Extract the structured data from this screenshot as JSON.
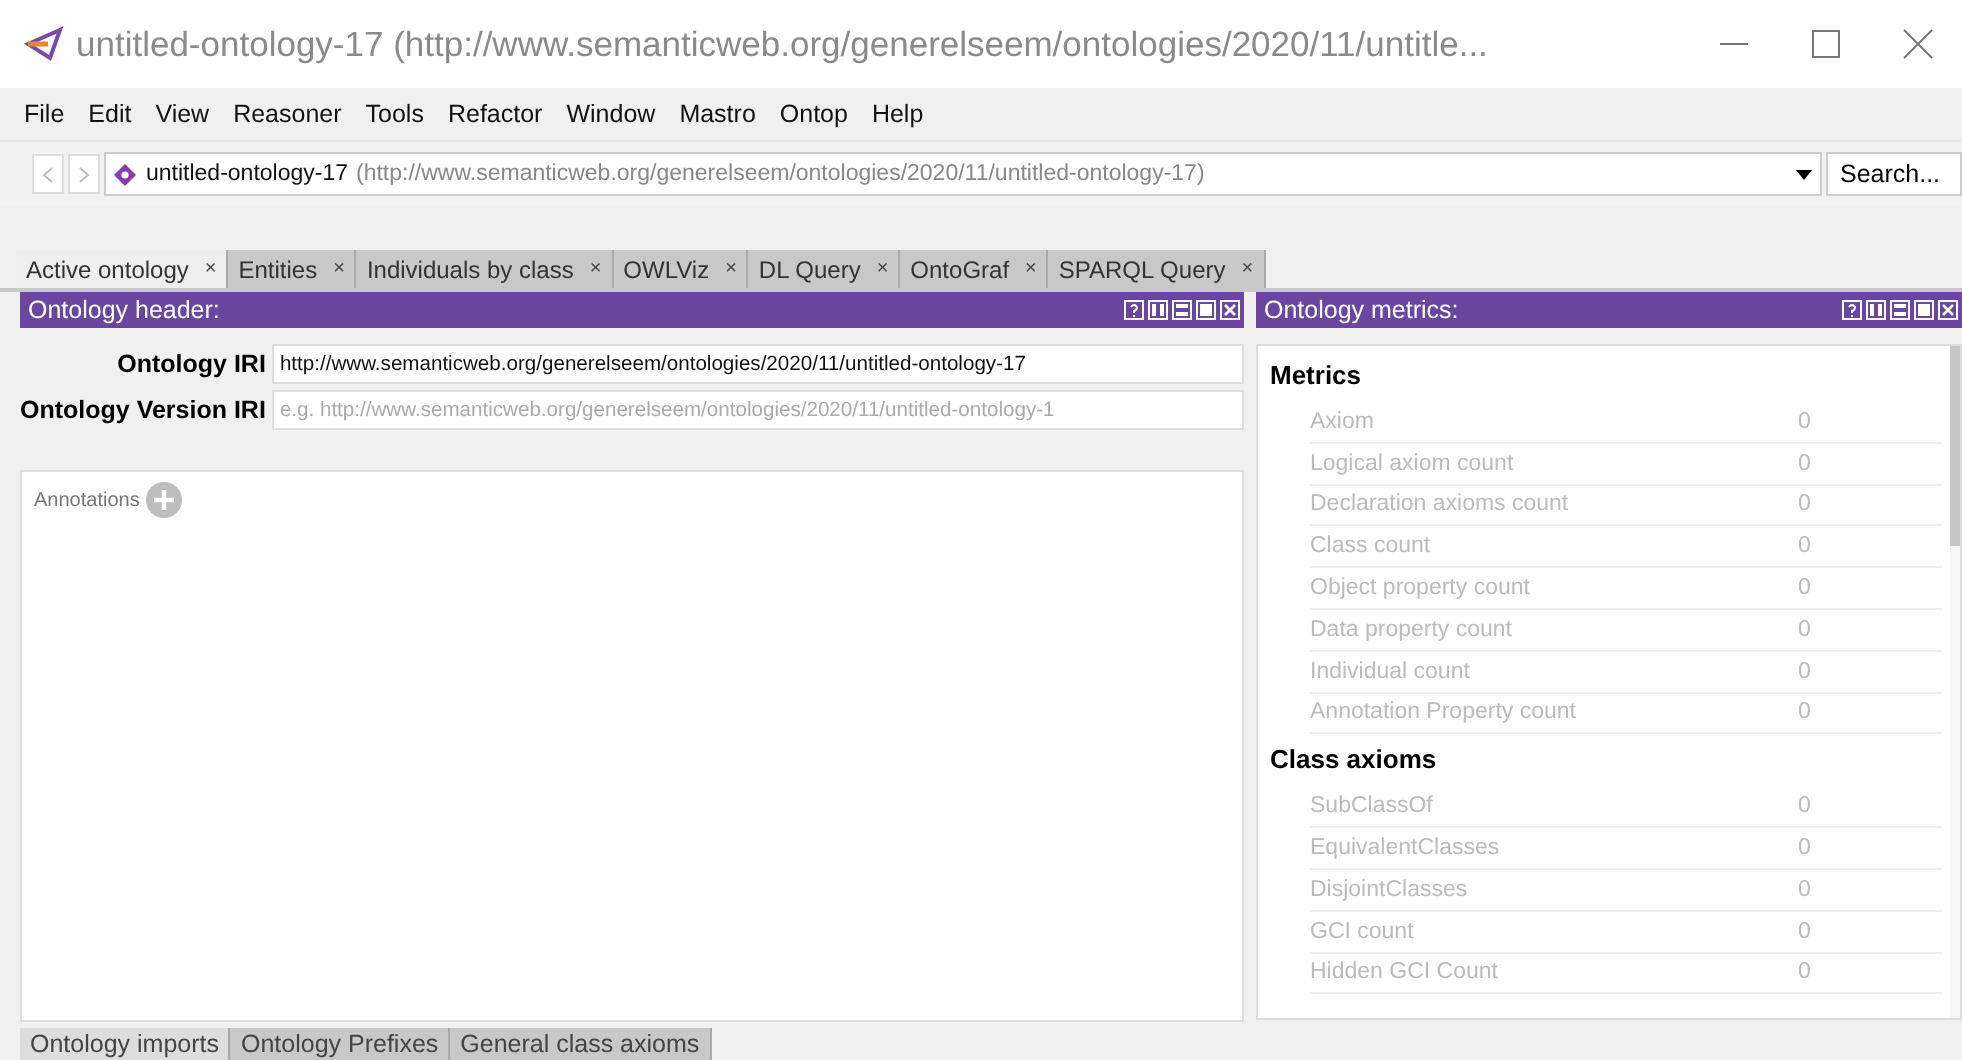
{
  "window": {
    "title": "untitled-ontology-17 (http://www.semanticweb.org/generelseem/ontologies/2020/11/untitle..."
  },
  "menu": [
    "File",
    "Edit",
    "View",
    "Reasoner",
    "Tools",
    "Refactor",
    "Window",
    "Mastro",
    "Ontop",
    "Help"
  ],
  "address": {
    "name": "untitled-ontology-17",
    "iri": "(http://www.semanticweb.org/generelseem/ontologies/2020/11/untitled-ontology-17)",
    "search": "Search..."
  },
  "tabs": [
    {
      "label": "Active ontology",
      "close": "×",
      "selected": true
    },
    {
      "label": "Entities",
      "close": "×",
      "selected": false
    },
    {
      "label": "Individuals by class",
      "close": "×",
      "selected": false
    },
    {
      "label": "OWLViz",
      "close": "×",
      "selected": false
    },
    {
      "label": "DL Query",
      "close": "×",
      "selected": false
    },
    {
      "label": "OntoGraf",
      "close": "×",
      "selected": false
    },
    {
      "label": "SPARQL Query",
      "close": "×",
      "selected": false
    }
  ],
  "header_panel": {
    "title": "Ontology header:",
    "fields": [
      {
        "label": "Ontology IRI",
        "value": "http://www.semanticweb.org/generelseem/ontologies/2020/11/untitled-ontology-17"
      },
      {
        "label": "Ontology Version IRI",
        "placeholder": "e.g. http://www.semanticweb.org/generelseem/ontologies/2020/11/untitled-ontology-1"
      }
    ],
    "annotations": "Annotations"
  },
  "metrics_panel": {
    "title": "Ontology metrics:",
    "sections": [
      {
        "heading": "Metrics",
        "rows": [
          {
            "name": "Axiom",
            "value": "0"
          },
          {
            "name": "Logical axiom count",
            "value": "0"
          },
          {
            "name": "Declaration axioms count",
            "value": "0"
          },
          {
            "name": "Class count",
            "value": "0"
          },
          {
            "name": "Object property count",
            "value": "0"
          },
          {
            "name": "Data property count",
            "value": "0"
          },
          {
            "name": "Individual count",
            "value": "0"
          },
          {
            "name": "Annotation Property count",
            "value": "0"
          }
        ]
      },
      {
        "heading": "Class axioms",
        "rows": [
          {
            "name": "SubClassOf",
            "value": "0"
          },
          {
            "name": "EquivalentClasses",
            "value": "0"
          },
          {
            "name": "DisjointClasses",
            "value": "0"
          },
          {
            "name": "GCI count",
            "value": "0"
          },
          {
            "name": "Hidden GCI Count",
            "value": "0"
          }
        ]
      }
    ]
  },
  "bottom_tabs": [
    {
      "label": "Ontology imports",
      "selected": true
    },
    {
      "label": "Ontology Prefixes",
      "selected": false
    },
    {
      "label": "General class axioms",
      "selected": false
    }
  ]
}
